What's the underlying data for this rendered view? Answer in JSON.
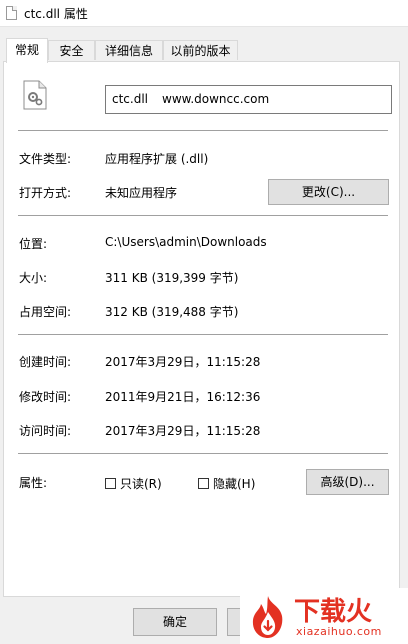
{
  "window": {
    "title": "ctc.dll 属性"
  },
  "tabs": [
    {
      "label": "常规",
      "active": true
    },
    {
      "label": "安全",
      "active": false
    },
    {
      "label": "详细信息",
      "active": false
    },
    {
      "label": "以前的版本",
      "active": false
    }
  ],
  "general": {
    "file_name": "ctc.dll",
    "file_name_extra": "www.downcc.com",
    "file_type_label": "文件类型:",
    "file_type_value": "应用程序扩展 (.dll)",
    "open_with_label": "打开方式:",
    "open_with_value": "未知应用程序",
    "change_button": "更改(C)...",
    "location_label": "位置:",
    "location_value": "C:\\Users\\admin\\Downloads",
    "size_label": "大小:",
    "size_value": "311 KB (319,399 字节)",
    "size_on_disk_label": "占用空间:",
    "size_on_disk_value": "312 KB (319,488 字节)",
    "created_label": "创建时间:",
    "created_value": "2017年3月29日，11:15:28",
    "modified_label": "修改时间:",
    "modified_value": "2011年9月21日，16:12:36",
    "accessed_label": "访问时间:",
    "accessed_value": "2017年3月29日，11:15:28",
    "attributes_label": "属性:",
    "readonly_label": "只读(R)",
    "readonly_checked": false,
    "hidden_label": "隐藏(H)",
    "hidden_checked": false,
    "advanced_button": "高级(D)..."
  },
  "footer": {
    "ok_button": "确定"
  },
  "watermark": {
    "brand": "下载火",
    "domain": "xiazaihuo.com"
  }
}
